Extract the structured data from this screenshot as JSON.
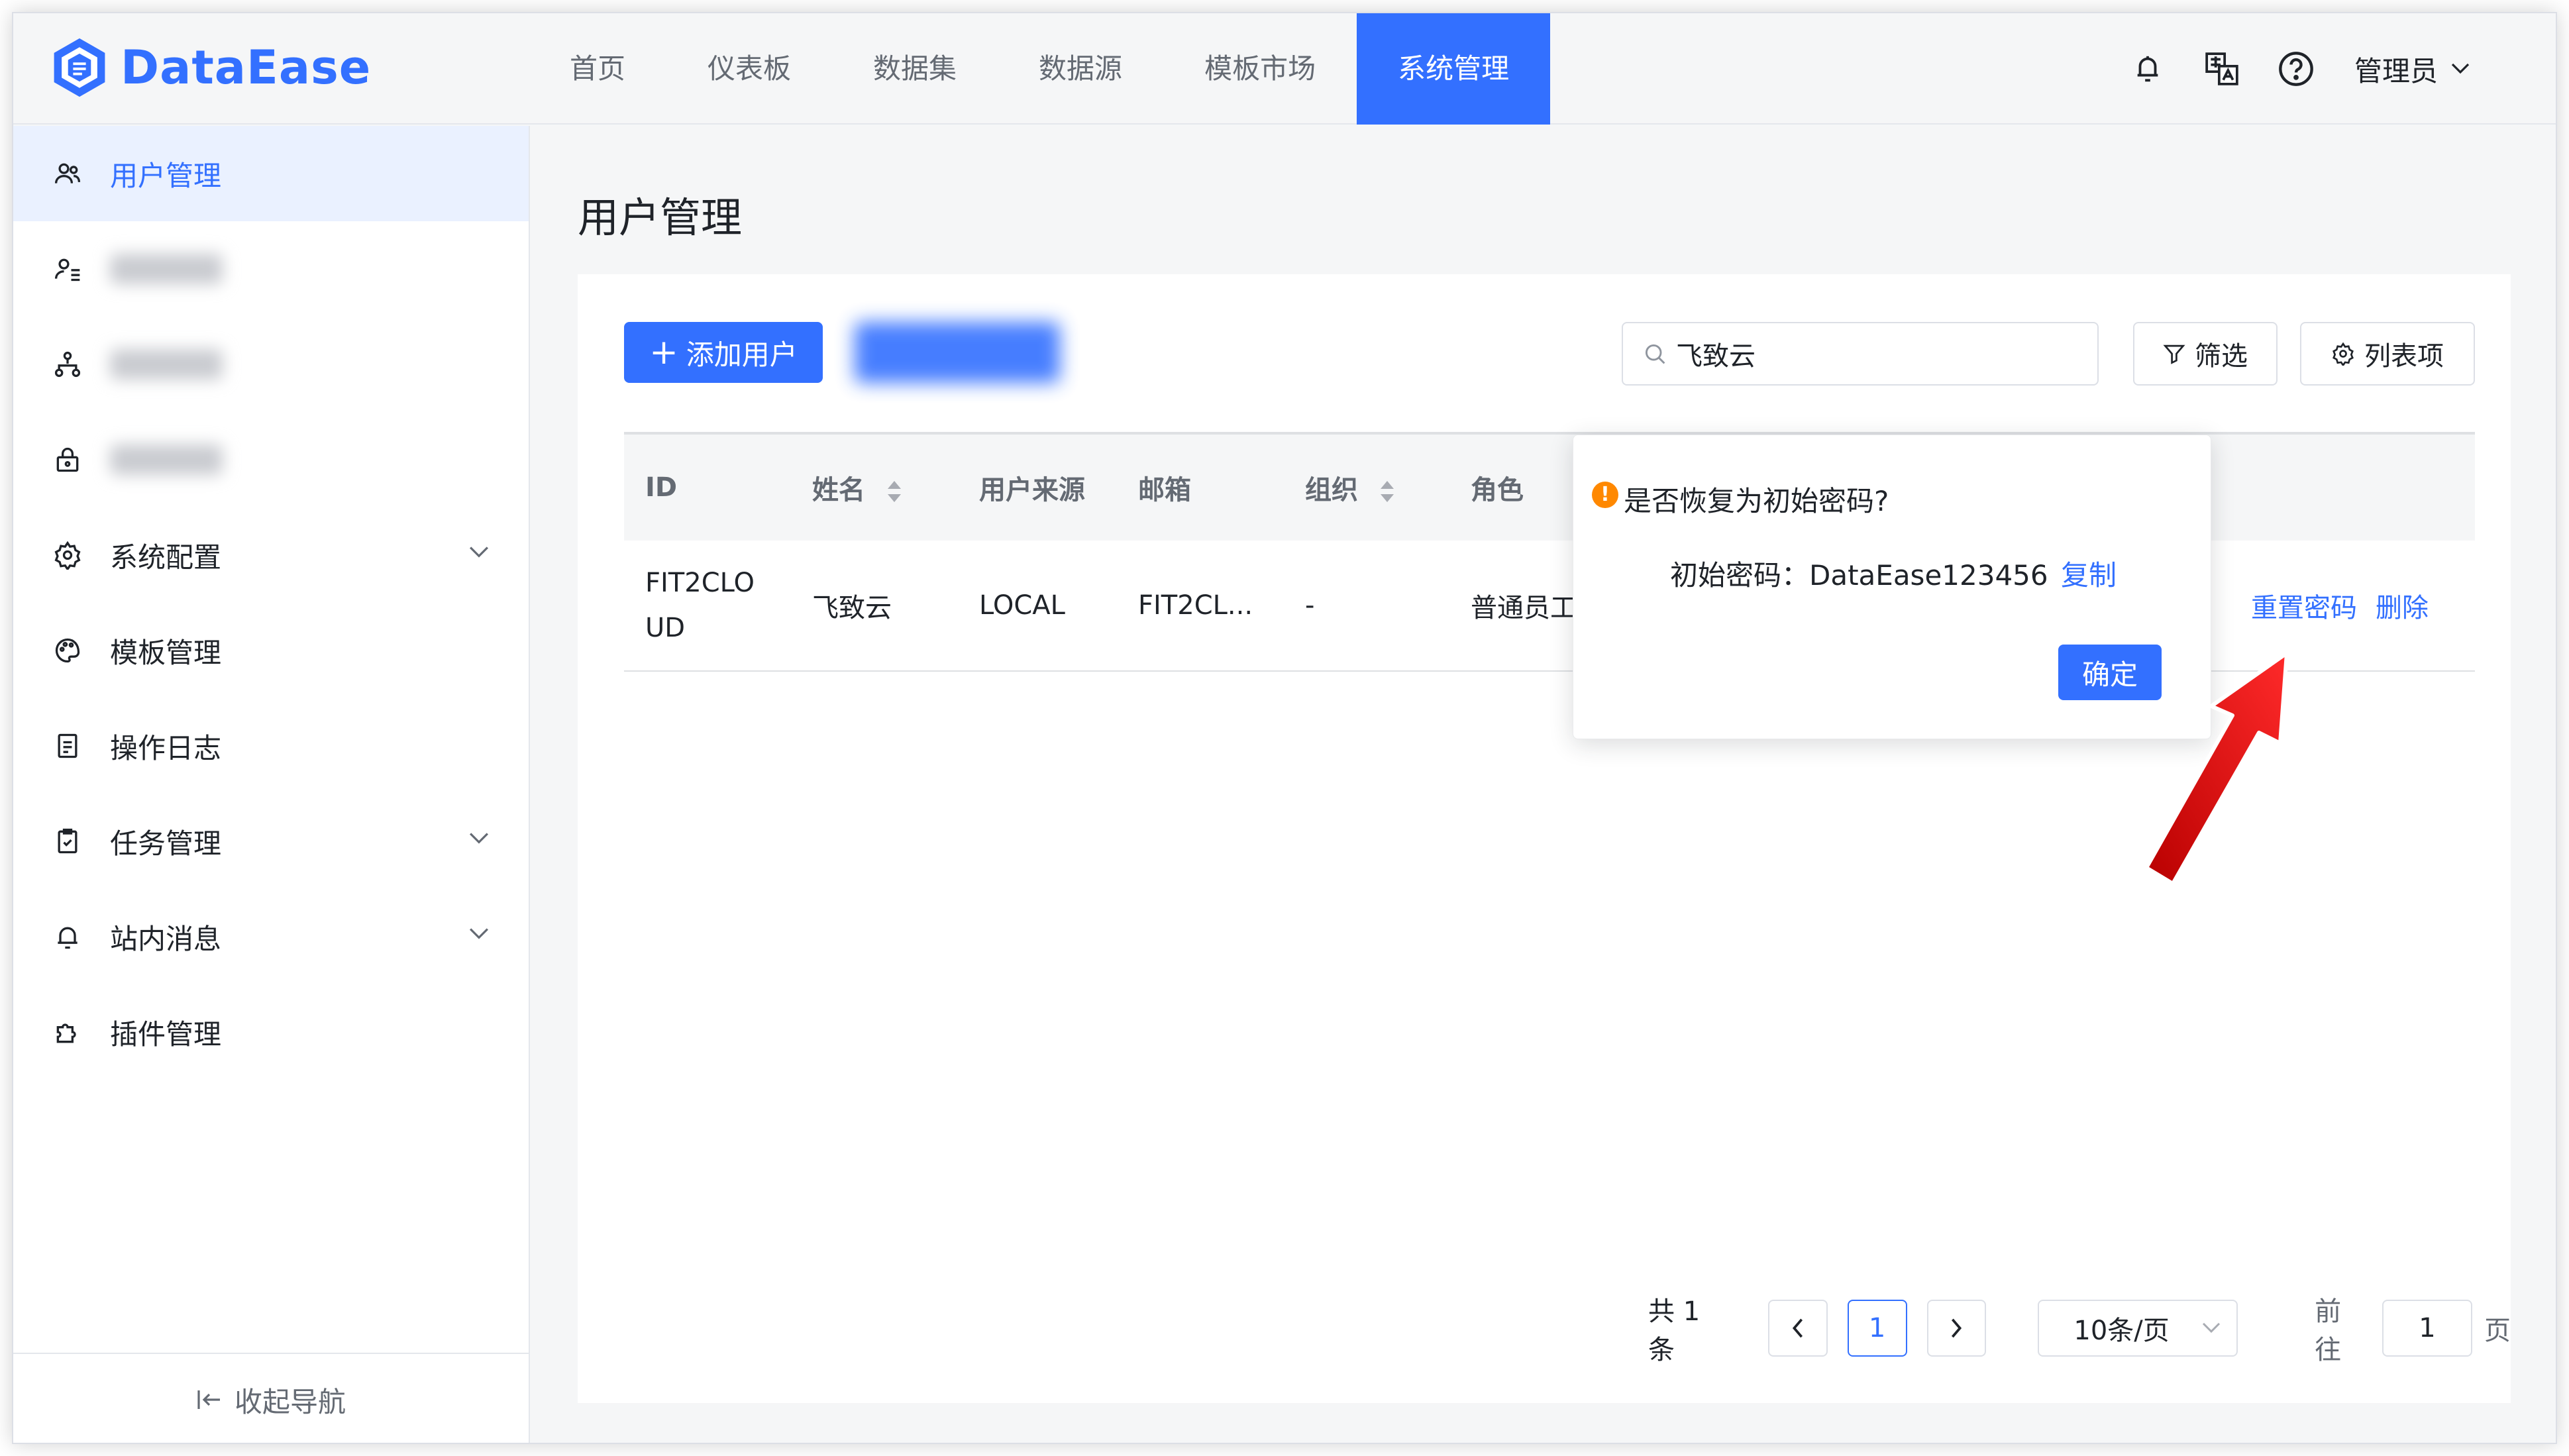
{
  "brand": {
    "name": "DataEase",
    "color": "#3370ff"
  },
  "nav": {
    "items": [
      {
        "label": "首页"
      },
      {
        "label": "仪表板"
      },
      {
        "label": "数据集"
      },
      {
        "label": "数据源"
      },
      {
        "label": "模板市场"
      },
      {
        "label": "系统管理",
        "active": true
      }
    ]
  },
  "header": {
    "icons": [
      "bell-icon",
      "translate-icon",
      "help-icon"
    ],
    "user_name": "管理员"
  },
  "sidebar": {
    "items": [
      {
        "label": "用户管理",
        "icon": "users-icon",
        "active": true
      },
      {
        "label": "",
        "icon": "user-list-icon",
        "blurred": true
      },
      {
        "label": "",
        "icon": "org-tree-icon",
        "blurred": true
      },
      {
        "label": "",
        "icon": "lock-icon",
        "blurred": true
      },
      {
        "label": "系统配置",
        "icon": "gear-icon",
        "expandable": true
      },
      {
        "label": "模板管理",
        "icon": "palette-icon"
      },
      {
        "label": "操作日志",
        "icon": "document-icon"
      },
      {
        "label": "任务管理",
        "icon": "clipboard-check-icon",
        "expandable": true
      },
      {
        "label": "站内消息",
        "icon": "bell-icon",
        "expandable": true
      },
      {
        "label": "插件管理",
        "icon": "puzzle-icon"
      }
    ],
    "collapse_label": "收起导航"
  },
  "page": {
    "title": "用户管理"
  },
  "toolbar": {
    "add_user_label": "添加用户",
    "search_value": "飞致云",
    "filter_label": "筛选",
    "columns_label": "列表项"
  },
  "table": {
    "headers": {
      "id": "ID",
      "name": "姓名",
      "source": "用户来源",
      "email": "邮箱",
      "org": "组织",
      "role": "角色"
    },
    "rows": [
      {
        "id_line1": "FIT2CLO",
        "id_line2": "UD",
        "name": "飞致云",
        "source": "LOCAL",
        "email": "FIT2CL...",
        "org": "-",
        "role": "普通员工",
        "action_reset": "重置密码",
        "action_delete": "删除"
      }
    ]
  },
  "popover": {
    "title": "是否恢复为初始密码?",
    "body": "初始密码：DataEase123456",
    "copy_label": "复制",
    "ok_label": "确定",
    "warning_color": "#ff8800"
  },
  "pagination": {
    "total_label": "共 1 条",
    "current_page": "1",
    "page_size_label": "10条/页",
    "goto_label": "前往",
    "goto_value": "1",
    "page_suffix": "页"
  }
}
